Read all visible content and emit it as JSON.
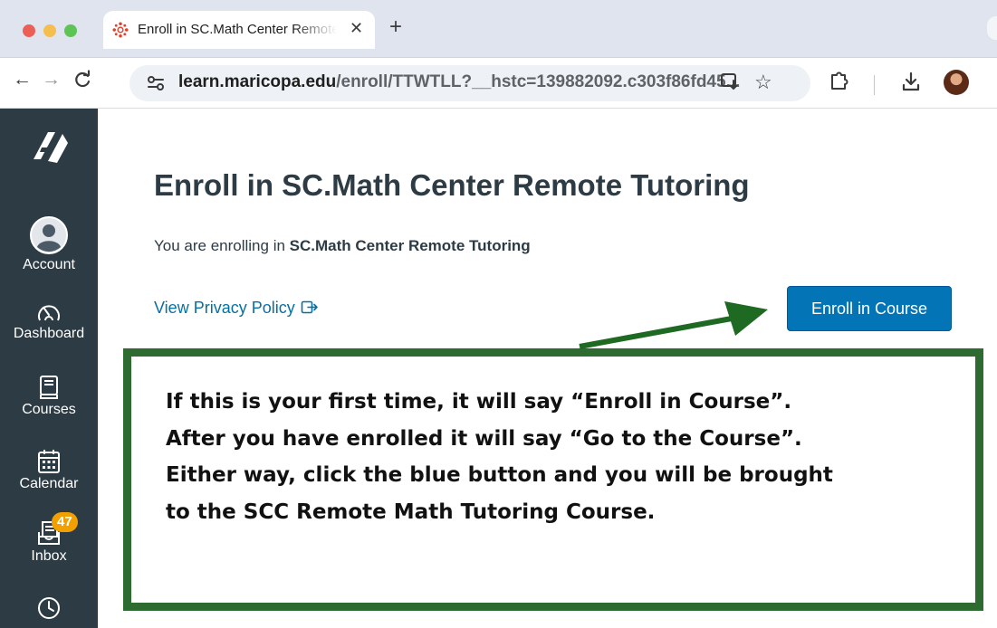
{
  "browser": {
    "tab": {
      "title": "Enroll in SC.Math Center Remote Tutoring"
    },
    "new_tab_symbol": "+",
    "close_symbol": "✕",
    "url_host": "learn.maricopa.edu",
    "url_path": "/enroll/TTWTLL?__hstc=139882092.c303f86fd45...",
    "icons": {
      "back": "←",
      "forward": "→",
      "reload": "C",
      "star": "☆",
      "install": "⊡"
    },
    "colors": {
      "tabbar": "#dfe4ee",
      "omnibox": "#eef1f6"
    }
  },
  "sidebar": {
    "items": [
      {
        "id": "account",
        "label": "Account",
        "icon": "user-avatar-icon"
      },
      {
        "id": "dashboard",
        "label": "Dashboard",
        "icon": "dashboard-gauge-icon"
      },
      {
        "id": "courses",
        "label": "Courses",
        "icon": "book-icon"
      },
      {
        "id": "calendar",
        "label": "Calendar",
        "icon": "calendar-icon"
      },
      {
        "id": "inbox",
        "label": "Inbox",
        "icon": "inbox-icon",
        "badge": "47"
      },
      {
        "id": "history",
        "label": "",
        "icon": "clock-icon"
      }
    ],
    "colors": {
      "background": "#2d3b45",
      "badge": "#f2a000"
    }
  },
  "main": {
    "title": "Enroll in SC.Math Center Remote Tutoring",
    "enroll_prefix": "You are enrolling in ",
    "enroll_course": "SC.Math Center Remote Tutoring",
    "privacy_link": "View Privacy Policy",
    "enroll_button": "Enroll in Course",
    "colors": {
      "button": "#0374b5",
      "link": "#0770a3"
    }
  },
  "callout": {
    "lines": [
      "If this is your first time, it will say “Enroll in Course”.",
      "After you have enrolled it will say “Go to the Course”.",
      "Either way, click the blue button and you will be brought",
      "to the SCC Remote Math Tutoring Course."
    ],
    "colors": {
      "border": "#2e6b30",
      "arrow": "#1f6a22"
    }
  }
}
